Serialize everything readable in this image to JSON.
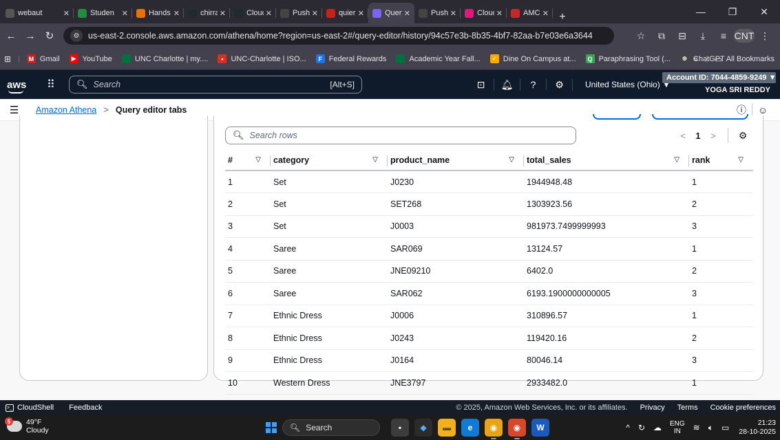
{
  "browser": {
    "tabs": [
      {
        "title": "webaut",
        "icon": "globe-icon",
        "color": "#555555"
      },
      {
        "title": "Studen",
        "icon": "student-icon",
        "color": "#1e8e3e"
      },
      {
        "title": "Hands",
        "icon": "hands-icon",
        "color": "#e8710a"
      },
      {
        "title": "chirrad",
        "icon": "github-icon",
        "color": "#24292e"
      },
      {
        "title": "CloudA",
        "icon": "github-icon",
        "color": "#24292e"
      },
      {
        "title": "Push fo",
        "icon": "openai-icon",
        "color": "#444444"
      },
      {
        "title": "quierie",
        "icon": "gmail-icon",
        "color": "#c5221f"
      },
      {
        "title": "Query",
        "icon": "athena-icon",
        "color": "#7b61ff"
      },
      {
        "title": "Push fo",
        "icon": "openai-icon",
        "color": "#444444"
      },
      {
        "title": "CloudV",
        "icon": "cloudwatch-icon",
        "color": "#e7157b"
      },
      {
        "title": "AMC S",
        "icon": "amc-icon",
        "color": "#c62828"
      }
    ],
    "active_tab": 7,
    "new_tab": "+",
    "url": "us-east-2.console.aws.amazon.com/athena/home?region=us-east-2#/query-editor/history/94c57e3b-8b35-4bf7-82aa-b7e03e6a3644",
    "profile_badge": "CNT",
    "bookmarks": [
      {
        "label": "Gmail",
        "icon": "gmail-icon",
        "color": "#c5221f",
        "glyph": "M"
      },
      {
        "label": "YouTube",
        "icon": "youtube-icon",
        "color": "#ff0000",
        "glyph": "▶"
      },
      {
        "label": "UNC Charlotte | my....",
        "icon": "unc-icon",
        "color": "#00703c",
        "glyph": ""
      },
      {
        "label": "UNC-Charlotte | ISO...",
        "icon": "unc-iso-icon",
        "color": "#d93025",
        "glyph": "•"
      },
      {
        "label": "Federal Rewards",
        "icon": "federal-icon",
        "color": "#1a73e8",
        "glyph": "F"
      },
      {
        "label": "Academic Year Fall...",
        "icon": "academic-icon",
        "color": "#00703c",
        "glyph": ""
      },
      {
        "label": "Dine On Campus at...",
        "icon": "dine-icon",
        "color": "#f9ab00",
        "glyph": "✓"
      },
      {
        "label": "Paraphrasing Tool (...",
        "icon": "paraphrase-icon",
        "color": "#34a853",
        "glyph": "Q"
      },
      {
        "label": "ChatGPT",
        "icon": "openai-icon",
        "color": "#444444",
        "glyph": "⊛"
      }
    ],
    "all_bookmarks": "All Bookmarks"
  },
  "aws": {
    "logo": "aws",
    "search_placeholder": "Search",
    "search_shortcut": "[Alt+S]",
    "region": "United States (Ohio) ▼",
    "account_id": "Account ID: 7044-4859-9249 ▼",
    "user": "YOGA SRI REDDY"
  },
  "breadcrumb": {
    "service": "Amazon Athena",
    "separator": ">",
    "current": "Query editor tabs"
  },
  "results": {
    "search_placeholder": "Search rows",
    "page": "1",
    "columns": [
      "#",
      "category",
      "product_name",
      "total_sales",
      "rank"
    ],
    "rows": [
      [
        "1",
        "Set",
        "J0230",
        "1944948.48",
        "1"
      ],
      [
        "2",
        "Set",
        "SET268",
        "1303923.56",
        "2"
      ],
      [
        "3",
        "Set",
        "J0003",
        "981973.7499999993",
        "3"
      ],
      [
        "4",
        "Saree",
        "SAR069",
        "13124.57",
        "1"
      ],
      [
        "5",
        "Saree",
        "JNE09210",
        "6402.0",
        "2"
      ],
      [
        "6",
        "Saree",
        "SAR062",
        "6193.1900000000005",
        "3"
      ],
      [
        "7",
        "Ethnic Dress",
        "J0006",
        "310896.57",
        "1"
      ],
      [
        "8",
        "Ethnic Dress",
        "J0243",
        "119420.16",
        "2"
      ],
      [
        "9",
        "Ethnic Dress",
        "J0164",
        "80046.14",
        "3"
      ],
      [
        "10",
        "Western Dress",
        "JNE3797",
        "2933482.0",
        "1"
      ]
    ]
  },
  "footer": {
    "cloudshell": "CloudShell",
    "feedback": "Feedback",
    "copyright": "© 2025, Amazon Web Services, Inc. or its affiliates.",
    "privacy": "Privacy",
    "terms": "Terms",
    "cookies": "Cookie preferences"
  },
  "taskbar": {
    "weather_temp": "49°F",
    "weather_desc": "Cloudy",
    "weather_badge": "5",
    "search_label": "Search",
    "lang_top": "ENG",
    "lang_bottom": "IN",
    "time": "21:23",
    "date": "28-10-2025"
  },
  "colors": {
    "aws_header": "#0f1b2a",
    "link": "#006ce0",
    "browser_chrome": "#42414d"
  }
}
